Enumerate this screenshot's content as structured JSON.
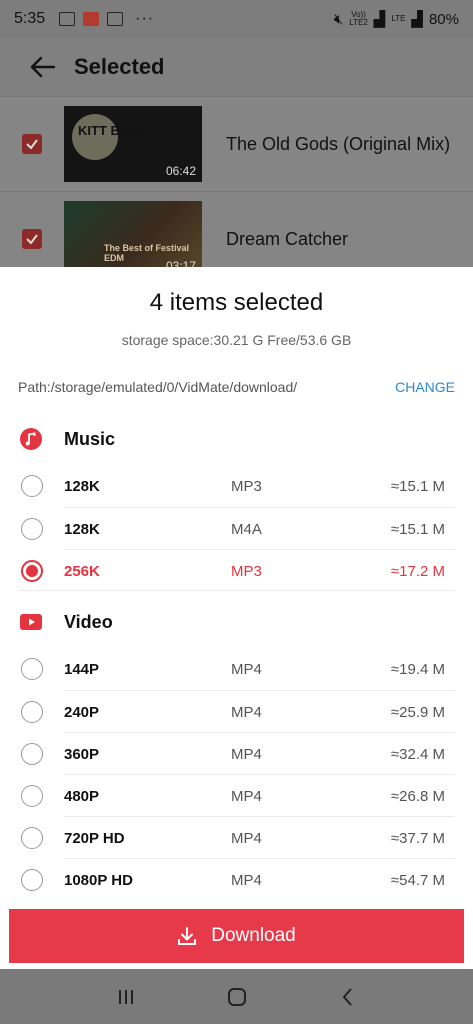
{
  "status_bar": {
    "time": "5:35",
    "dots": "···",
    "lte1": "Vo))",
    "lte2": "LTE2",
    "lte3": "LTE",
    "battery": "80%"
  },
  "app_header": {
    "title": "Selected"
  },
  "background_items": [
    {
      "title": "The Old Gods (Original Mix)",
      "duration": "06:42",
      "thumb_text": "KITT BALL"
    },
    {
      "title": "Dream Catcher",
      "duration": "03:17",
      "thumb_text": "The Best of Festival EDM"
    }
  ],
  "sheet": {
    "title": "4 items selected",
    "storage": "storage space:30.21 G Free/53.6 GB",
    "path": "Path:/storage/emulated/0/VidMate/download/",
    "change_label": "CHANGE",
    "music": {
      "label": "Music",
      "options": [
        {
          "quality": "128K",
          "format": "MP3",
          "size": "≈15.1 M",
          "selected": false
        },
        {
          "quality": "128K",
          "format": "M4A",
          "size": "≈15.1 M",
          "selected": false
        },
        {
          "quality": "256K",
          "format": "MP3",
          "size": "≈17.2 M",
          "selected": true
        }
      ]
    },
    "video": {
      "label": "Video",
      "options": [
        {
          "quality": "144P",
          "format": "MP4",
          "size": "≈19.4 M",
          "selected": false
        },
        {
          "quality": "240P",
          "format": "MP4",
          "size": "≈25.9 M",
          "selected": false
        },
        {
          "quality": "360P",
          "format": "MP4",
          "size": "≈32.4 M",
          "selected": false
        },
        {
          "quality": "480P",
          "format": "MP4",
          "size": "≈26.8 M",
          "selected": false
        },
        {
          "quality": "720P HD",
          "format": "MP4",
          "size": "≈37.7 M",
          "selected": false
        },
        {
          "quality": "1080P HD",
          "format": "MP4",
          "size": "≈54.7 M",
          "selected": false
        }
      ]
    },
    "download_label": "Download"
  },
  "colors": {
    "accent": "#e6394a",
    "link": "#2a8ad6"
  },
  "icons": [
    "back-arrow-icon",
    "music-note-icon",
    "youtube-play-icon",
    "download-icon",
    "recents-icon",
    "home-icon",
    "back-nav-icon"
  ]
}
